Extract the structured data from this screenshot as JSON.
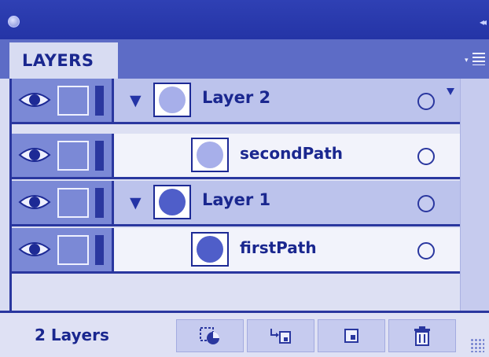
{
  "panel": {
    "tab_label": "LAYERS",
    "collapse_glyph": "◂◂",
    "footer_count": "2 Layers"
  },
  "layers": [
    {
      "name": "Layer 2",
      "kind": "layer",
      "expanded": true,
      "swatch_color": "#a7afea"
    },
    {
      "name": "secondPath",
      "kind": "path",
      "swatch_color": "#a7afea"
    },
    {
      "name": "Layer 1",
      "kind": "layer",
      "expanded": true,
      "swatch_color": "#4f5ec9"
    },
    {
      "name": "firstPath",
      "kind": "path",
      "swatch_color": "#4f5ec9"
    }
  ],
  "footer_buttons": [
    {
      "icon": "make-clipping-mask-icon"
    },
    {
      "icon": "create-sublayer-icon"
    },
    {
      "icon": "create-new-layer-icon"
    },
    {
      "icon": "trash-icon"
    }
  ],
  "colors": {
    "panel_blue": "#2434a6",
    "layer_row": "#bcc3ec",
    "path_row": "#f2f3fb",
    "control_column": "#7b89d6"
  }
}
